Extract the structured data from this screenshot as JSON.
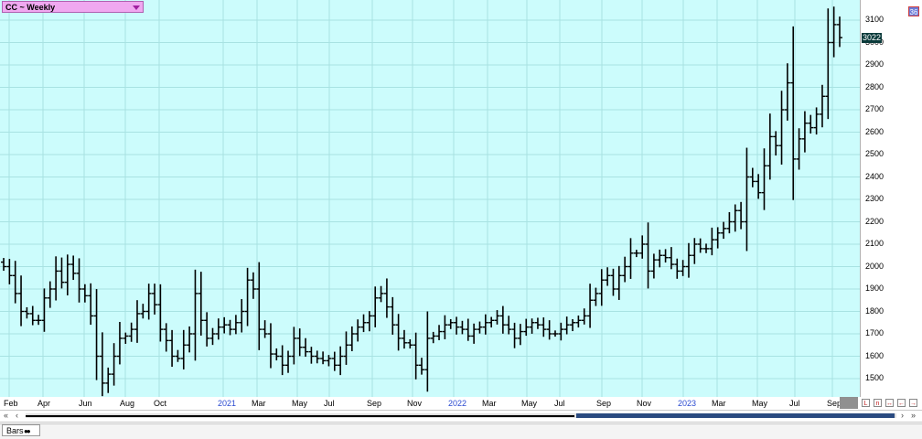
{
  "window": {
    "title": "CC ~ Weekly",
    "corner_badge": "36",
    "tab_label": "Bars",
    "tab_icon": "●●"
  },
  "colors": {
    "plot_background": "#ccfcfc",
    "gridline": "#a8e2e2",
    "bars": "#000000",
    "title_box": "#f0a8f0",
    "last_price_box": "#0a3a3a"
  },
  "icons": [
    "dropdown-icon",
    "scroll-left-icon",
    "scroll-right-icon",
    "nav-button-icons"
  ],
  "chart_data": {
    "type": "ohlc",
    "title": "CC ~ Weekly",
    "last_price": "3022",
    "ylim": [
      1430,
      3180
    ],
    "grid": true,
    "y_ticks": [
      1500,
      1600,
      1700,
      1800,
      1900,
      2000,
      2100,
      2200,
      2300,
      2400,
      2500,
      2600,
      2700,
      2800,
      2900,
      3000,
      3100
    ],
    "x_ticks": [
      {
        "label": "Feb",
        "year": false
      },
      {
        "label": "Apr",
        "year": false
      },
      {
        "label": "Jun",
        "year": false
      },
      {
        "label": "Aug",
        "year": false
      },
      {
        "label": "Oct",
        "year": false
      },
      {
        "label": "2021",
        "year": true
      },
      {
        "label": "Mar",
        "year": false
      },
      {
        "label": "May",
        "year": false
      },
      {
        "label": "Jul",
        "year": false
      },
      {
        "label": "Sep",
        "year": false
      },
      {
        "label": "Nov",
        "year": false
      },
      {
        "label": "2022",
        "year": true
      },
      {
        "label": "Mar",
        "year": false
      },
      {
        "label": "May",
        "year": false
      },
      {
        "label": "Jul",
        "year": false
      },
      {
        "label": "Sep",
        "year": false
      },
      {
        "label": "Nov",
        "year": false
      },
      {
        "label": "2023",
        "year": true
      },
      {
        "label": "Mar",
        "year": false
      },
      {
        "label": "May",
        "year": false
      },
      {
        "label": "Jul",
        "year": false
      },
      {
        "label": "Sep",
        "year": false
      }
    ],
    "closes": [
      2000,
      1960,
      1880,
      1800,
      1790,
      1760,
      1760,
      1860,
      1900,
      1980,
      1930,
      2010,
      1970,
      1900,
      1870,
      1780,
      1600,
      1480,
      1520,
      1600,
      1680,
      1690,
      1720,
      1790,
      1800,
      1880,
      1830,
      1720,
      1670,
      1600,
      1590,
      1650,
      1700,
      1880,
      1760,
      1680,
      1700,
      1730,
      1740,
      1720,
      1750,
      1800,
      1940,
      1900,
      1720,
      1700,
      1610,
      1600,
      1560,
      1600,
      1680,
      1640,
      1620,
      1600,
      1590,
      1580,
      1590,
      1560,
      1600,
      1650,
      1700,
      1730,
      1750,
      1780,
      1860,
      1880,
      1820,
      1740,
      1680,
      1660,
      1650,
      1560,
      1540,
      1680,
      1690,
      1710,
      1740,
      1750,
      1730,
      1720,
      1690,
      1720,
      1730,
      1750,
      1760,
      1780,
      1740,
      1720,
      1680,
      1710,
      1730,
      1750,
      1740,
      1720,
      1700,
      1700,
      1720,
      1740,
      1750,
      1760,
      1780,
      1850,
      1880,
      1940,
      1960,
      1900,
      1960,
      2000,
      2060,
      2060,
      2100,
      1980,
      2030,
      2050,
      2040,
      2010,
      1980,
      2000,
      2050,
      2100,
      2080,
      2080,
      2120,
      2150,
      2170,
      2200,
      2250,
      2200,
      2400,
      2380,
      2330,
      2450,
      2580,
      2540,
      2700,
      2820,
      2480,
      2570,
      2640,
      2620,
      2680,
      2760,
      3000,
      3080,
      3022
    ]
  }
}
